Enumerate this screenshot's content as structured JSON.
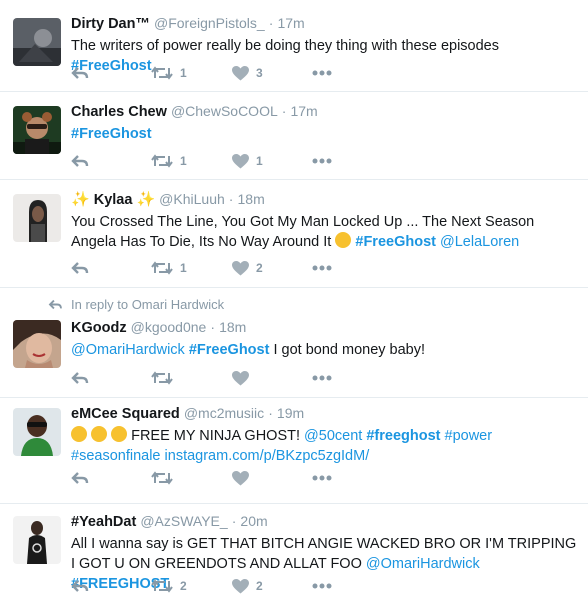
{
  "tweets": [
    {
      "name": "Dirty Dan™",
      "handle": "@ForeignPistols_",
      "sep": "·",
      "time": "17m",
      "text_plain": "The writers of power really be doing they thing with these episodes ",
      "hashtag1": "#FreeGhost",
      "retweets": "1",
      "likes": "3"
    },
    {
      "name": "Charles Chew",
      "handle": "@ChewSoCOOL",
      "sep": "·",
      "time": "17m",
      "hashtag1": "#FreeGhost",
      "retweets": "1",
      "likes": "1"
    },
    {
      "name": "Kylaa",
      "name_decor_left": "✨",
      "name_decor_right": "✨",
      "handle": "@KhiLuuh",
      "sep": "·",
      "time": "18m",
      "text_plain": "You Crossed The Line, You Got My Man Locked Up ... The Next Season Angela Has To Die, Its No Way Around It ",
      "hashtag1": "#FreeGhost",
      "mention1": "@LelaLoren",
      "retweets": "1",
      "likes": "2"
    },
    {
      "reply_context": "In reply to Omari Hardwick",
      "name": "KGoodz",
      "handle": "@kgood0ne",
      "sep": "·",
      "time": "18m",
      "mention1": "@OmariHardwick",
      "hashtag1": "#FreeGhost",
      "text_plain": " I got bond money baby!"
    },
    {
      "name": "eMCee Squared",
      "handle": "@mc2musiic",
      "sep": "·",
      "time": "19m",
      "text_plain": " FREE MY NINJA GHOST! ",
      "mention1": "@50cent",
      "hashtag1": "#freeghost",
      "hashtag2": "#power",
      "hashtag3": "#seasonfinale",
      "link1": "instagram.com/p/BKzpc5zgIdM/"
    },
    {
      "name": "#YeahDat",
      "handle": "@AzSWAYE_",
      "sep": "·",
      "time": "20m",
      "text_plain": "All I wanna say is GET THAT BITCH ANGIE WACKED BRO OR I'M TRIPPING I GOT U ON GREENDOTS AND ALLAT FOO ",
      "mention1": "@OmariHardwick",
      "hashtag1": "#FREEGHOST",
      "retweets": "2",
      "likes": "2"
    }
  ],
  "colors": {
    "link": "#1b95e0",
    "muted": "#8899a6",
    "divider": "#e6ecf0"
  },
  "icons": [
    "reply-icon",
    "retweet-icon",
    "heart-icon",
    "more-icon"
  ]
}
